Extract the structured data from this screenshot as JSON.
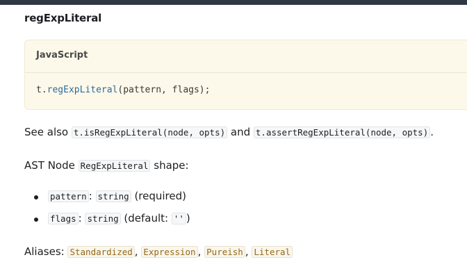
{
  "heading": "regExpLiteral",
  "code_block": {
    "language": "JavaScript",
    "prefix": "t.",
    "method": "regExpLiteral",
    "args": "(pattern, flags);"
  },
  "see_also": {
    "prefix": "See also ",
    "code1": "t.isRegExpLiteral(node, opts)",
    "middle": " and ",
    "code2": "t.assertRegExpLiteral(node, opts)",
    "suffix": "."
  },
  "shape": {
    "prefix": "AST Node ",
    "code": "RegExpLiteral",
    "suffix": " shape:"
  },
  "fields": [
    {
      "name": "pattern",
      "sep": ": ",
      "type": "string",
      "note": " (required)",
      "default_code": ""
    },
    {
      "name": "flags",
      "sep": ": ",
      "type": "string",
      "note": " (default: ",
      "default_code": "''",
      "note_end": ")"
    }
  ],
  "aliases": {
    "label": "Aliases: ",
    "items": [
      "Standardized",
      "Expression",
      "Pureish",
      "Literal"
    ],
    "separator": ", "
  }
}
